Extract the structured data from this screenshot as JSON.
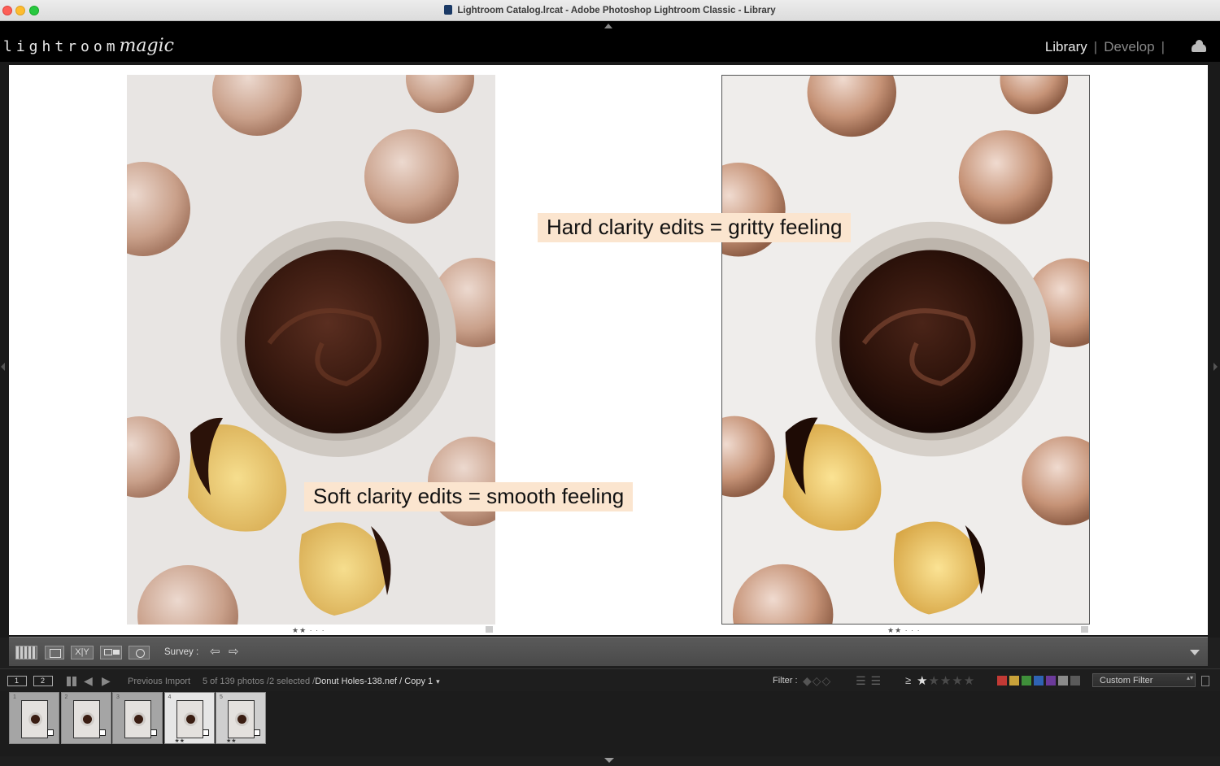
{
  "window": {
    "title": "Lightroom Catalog.lrcat - Adobe Photoshop Lightroom Classic - Library"
  },
  "header": {
    "logo_text": "lightroom",
    "logo_script": "magic",
    "modules": {
      "library": "Library",
      "develop": "Develop",
      "separator": "|"
    }
  },
  "main": {
    "left_photo": {
      "rating": "★★ · · ·"
    },
    "right_photo": {
      "rating": "★★ · · ·"
    },
    "annotations": {
      "hard": "Hard clarity edits = gritty feeling",
      "soft": "Soft clarity edits = smooth feeling"
    }
  },
  "toolbar": {
    "xy_label": "X|Y",
    "mode_label": "Survey :",
    "prev_arrow": "⇦",
    "next_arrow": "⇨"
  },
  "filmstrip_bar": {
    "screen1": "1",
    "screen2": "2",
    "back_arrow": "◀",
    "forward_arrow": "▶",
    "source": "Previous Import",
    "count": "5 of 139 photos /2 selected /",
    "file": "Donut Holes-138.nef / Copy 1",
    "filter_label": "Filter :",
    "ge": "≥",
    "custom_filter": "Custom Filter",
    "colors": [
      "#c23a35",
      "#c9a23a",
      "#3f8f3a",
      "#2f63b3",
      "#6b3a9a",
      "#8a8a8a",
      "#5a5a5a"
    ]
  },
  "filmstrip": {
    "cells": [
      {
        "num": "1",
        "stars": "",
        "state": "normal"
      },
      {
        "num": "2",
        "stars": "",
        "state": "normal"
      },
      {
        "num": "3",
        "stars": "",
        "state": "normal"
      },
      {
        "num": "4",
        "stars": "★★",
        "state": "current"
      },
      {
        "num": "5",
        "stars": "★★",
        "state": "selected"
      }
    ]
  }
}
